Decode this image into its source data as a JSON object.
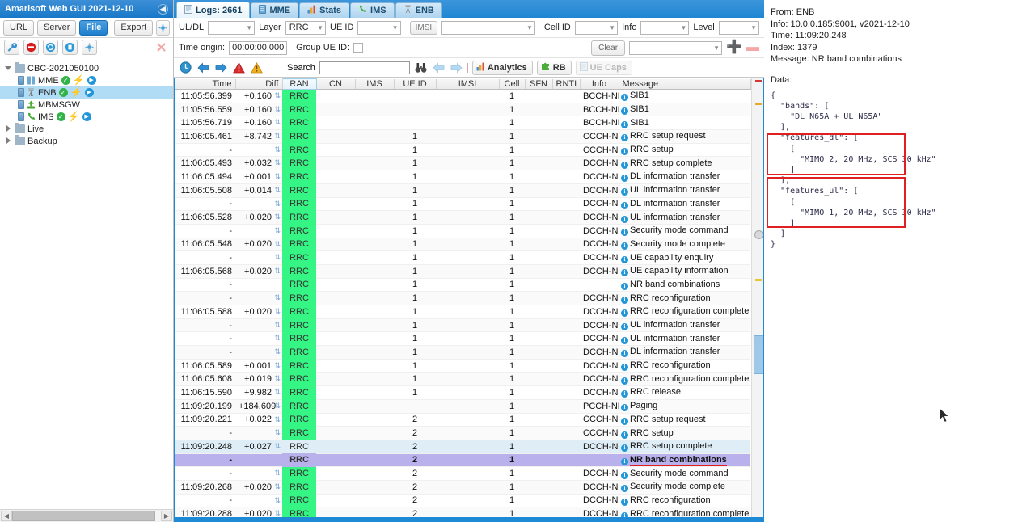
{
  "window": {
    "title": "Amarisoft Web GUI 2021-12-10",
    "collapse_icon": "chevron-left-icon"
  },
  "left_toolbar": {
    "url_label": "URL",
    "server_label": "Server",
    "file_label": "File",
    "export_label": "Export",
    "add_icon": "add-node-icon",
    "tools": [
      "wrench-icon",
      "stop-icon",
      "refresh-icon",
      "pause-icon",
      "connect-icon"
    ],
    "delete_icon": "delete-icon"
  },
  "tree": [
    {
      "label": "CBC-2021050100",
      "type": "folder",
      "twisty": "open",
      "indent": 0,
      "selected": false,
      "badges": []
    },
    {
      "label": "MME",
      "type": "server",
      "twisty": "none",
      "indent": 1,
      "selected": false,
      "badges": [
        "ok",
        "bolt",
        "play"
      ]
    },
    {
      "label": "ENB",
      "type": "server",
      "twisty": "none",
      "indent": 1,
      "selected": true,
      "badges": [
        "ok",
        "bolt",
        "play"
      ]
    },
    {
      "label": "MBMSGW",
      "type": "server",
      "twisty": "none",
      "indent": 1,
      "selected": false,
      "badges": []
    },
    {
      "label": "IMS",
      "type": "server",
      "twisty": "none",
      "indent": 1,
      "selected": false,
      "badges": [
        "ok",
        "bolt",
        "play"
      ]
    },
    {
      "label": "Live",
      "type": "folder",
      "twisty": "closed",
      "indent": 0,
      "selected": false,
      "badges": []
    },
    {
      "label": "Backup",
      "type": "folder",
      "twisty": "closed",
      "indent": 0,
      "selected": false,
      "badges": []
    }
  ],
  "tabs": [
    {
      "label": "Logs: 2661",
      "icon": "document-icon",
      "active": true
    },
    {
      "label": "MME",
      "icon": "server-icon",
      "active": false
    },
    {
      "label": "Stats",
      "icon": "bar-chart-icon",
      "active": false
    },
    {
      "label": "IMS",
      "icon": "phone-icon",
      "active": false
    },
    {
      "label": "ENB",
      "icon": "antenna-icon",
      "active": false
    }
  ],
  "filters": {
    "uldl_label": "UL/DL",
    "uldl_value": "",
    "layer_label": "Layer",
    "layer_value": "RRC",
    "ueid_label": "UE ID",
    "ueid_value": "",
    "imsi_button": "IMSI",
    "imsi_value": "",
    "cellid_label": "Cell ID",
    "cellid_value": "",
    "info_label": "Info",
    "info_value": "",
    "level_label": "Level",
    "level_value": "",
    "time_origin_label": "Time origin:",
    "time_origin_value": "00:00:00.000",
    "group_ueid_label": "Group UE ID:",
    "group_ueid_checked": false,
    "clear_label": "Clear",
    "preset_value": "",
    "add_icon": "plus-icon",
    "remove_icon": "minus-icon"
  },
  "toolbar2": {
    "clock_icon": "clock-icon",
    "prev_icon": "arrow-left-icon",
    "next_icon": "arrow-right-icon",
    "error_icon": "error-triangle-icon",
    "warning_icon": "warning-triangle-icon",
    "search_label": "Search",
    "search_value": "",
    "search_placeholder": "",
    "binoculars_icon": "binoculars-icon",
    "search_prev_icon": "arrow-left-icon",
    "search_next_icon": "arrow-right-icon",
    "analytics_label": "Analytics",
    "analytics_icon": "bar-chart-icon",
    "rb_label": "RB",
    "rb_icon": "puzzle-icon",
    "uecaps_label": "UE Caps",
    "uecaps_icon": "page-icon",
    "uecaps_disabled": true
  },
  "table": {
    "columns": [
      "Time",
      "Diff",
      "RAN",
      "CN",
      "IMS",
      "UE ID",
      "IMSI",
      "Cell",
      "SFN",
      "RNTI",
      "Info",
      "Message"
    ],
    "rows": [
      {
        "time": "11:05:56.399",
        "diff": "+0.160",
        "ran": "RRC",
        "cn": "",
        "ims": "",
        "ueid": "",
        "imsi": "",
        "cell": "1",
        "sfn": "",
        "rnti": "",
        "info": "BCCH-NR",
        "message": "SIB1",
        "state": "normal"
      },
      {
        "time": "11:05:56.559",
        "diff": "+0.160",
        "ran": "RRC",
        "cn": "",
        "ims": "",
        "ueid": "",
        "imsi": "",
        "cell": "1",
        "sfn": "",
        "rnti": "",
        "info": "BCCH-NR",
        "message": "SIB1",
        "state": "alt"
      },
      {
        "time": "11:05:56.719",
        "diff": "+0.160",
        "ran": "RRC",
        "cn": "",
        "ims": "",
        "ueid": "",
        "imsi": "",
        "cell": "1",
        "sfn": "",
        "rnti": "",
        "info": "BCCH-NR",
        "message": "SIB1",
        "state": "normal"
      },
      {
        "time": "11:06:05.461",
        "diff": "+8.742",
        "ran": "RRC",
        "cn": "",
        "ims": "",
        "ueid": "1",
        "imsi": "",
        "cell": "1",
        "sfn": "",
        "rnti": "",
        "info": "CCCH-NR",
        "message": "RRC setup request",
        "state": "alt"
      },
      {
        "time": "-",
        "diff": "",
        "ran": "RRC",
        "cn": "",
        "ims": "",
        "ueid": "1",
        "imsi": "",
        "cell": "1",
        "sfn": "",
        "rnti": "",
        "info": "CCCH-NR",
        "message": "RRC setup",
        "state": "normal"
      },
      {
        "time": "11:06:05.493",
        "diff": "+0.032",
        "ran": "RRC",
        "cn": "",
        "ims": "",
        "ueid": "1",
        "imsi": "",
        "cell": "1",
        "sfn": "",
        "rnti": "",
        "info": "DCCH-NR",
        "message": "RRC setup complete",
        "state": "alt"
      },
      {
        "time": "11:06:05.494",
        "diff": "+0.001",
        "ran": "RRC",
        "cn": "",
        "ims": "",
        "ueid": "1",
        "imsi": "",
        "cell": "1",
        "sfn": "",
        "rnti": "",
        "info": "DCCH-NR",
        "message": "DL information transfer",
        "state": "normal"
      },
      {
        "time": "11:06:05.508",
        "diff": "+0.014",
        "ran": "RRC",
        "cn": "",
        "ims": "",
        "ueid": "1",
        "imsi": "",
        "cell": "1",
        "sfn": "",
        "rnti": "",
        "info": "DCCH-NR",
        "message": "UL information transfer",
        "state": "alt"
      },
      {
        "time": "-",
        "diff": "",
        "ran": "RRC",
        "cn": "",
        "ims": "",
        "ueid": "1",
        "imsi": "",
        "cell": "1",
        "sfn": "",
        "rnti": "",
        "info": "DCCH-NR",
        "message": "DL information transfer",
        "state": "normal"
      },
      {
        "time": "11:06:05.528",
        "diff": "+0.020",
        "ran": "RRC",
        "cn": "",
        "ims": "",
        "ueid": "1",
        "imsi": "",
        "cell": "1",
        "sfn": "",
        "rnti": "",
        "info": "DCCH-NR",
        "message": "UL information transfer",
        "state": "alt"
      },
      {
        "time": "-",
        "diff": "",
        "ran": "RRC",
        "cn": "",
        "ims": "",
        "ueid": "1",
        "imsi": "",
        "cell": "1",
        "sfn": "",
        "rnti": "",
        "info": "DCCH-NR",
        "message": "Security mode command",
        "state": "normal"
      },
      {
        "time": "11:06:05.548",
        "diff": "+0.020",
        "ran": "RRC",
        "cn": "",
        "ims": "",
        "ueid": "1",
        "imsi": "",
        "cell": "1",
        "sfn": "",
        "rnti": "",
        "info": "DCCH-NR",
        "message": "Security mode complete",
        "state": "alt"
      },
      {
        "time": "-",
        "diff": "",
        "ran": "RRC",
        "cn": "",
        "ims": "",
        "ueid": "1",
        "imsi": "",
        "cell": "1",
        "sfn": "",
        "rnti": "",
        "info": "DCCH-NR",
        "message": "UE capability enquiry",
        "state": "normal"
      },
      {
        "time": "11:06:05.568",
        "diff": "+0.020",
        "ran": "RRC",
        "cn": "",
        "ims": "",
        "ueid": "1",
        "imsi": "",
        "cell": "1",
        "sfn": "",
        "rnti": "",
        "info": "DCCH-NR",
        "message": "UE capability information",
        "state": "alt"
      },
      {
        "time": "-",
        "diff": "",
        "ran": "RRC",
        "cn": "",
        "ims": "",
        "ueid": "1",
        "imsi": "",
        "cell": "1",
        "sfn": "",
        "rnti": "",
        "info": "",
        "message": "NR band combinations",
        "state": "normal"
      },
      {
        "time": "-",
        "diff": "",
        "ran": "RRC",
        "cn": "",
        "ims": "",
        "ueid": "1",
        "imsi": "",
        "cell": "1",
        "sfn": "",
        "rnti": "",
        "info": "DCCH-NR",
        "message": "RRC reconfiguration",
        "state": "alt"
      },
      {
        "time": "11:06:05.588",
        "diff": "+0.020",
        "ran": "RRC",
        "cn": "",
        "ims": "",
        "ueid": "1",
        "imsi": "",
        "cell": "1",
        "sfn": "",
        "rnti": "",
        "info": "DCCH-NR",
        "message": "RRC reconfiguration complete",
        "state": "normal"
      },
      {
        "time": "-",
        "diff": "",
        "ran": "RRC",
        "cn": "",
        "ims": "",
        "ueid": "1",
        "imsi": "",
        "cell": "1",
        "sfn": "",
        "rnti": "",
        "info": "DCCH-NR",
        "message": "UL information transfer",
        "state": "alt"
      },
      {
        "time": "-",
        "diff": "",
        "ran": "RRC",
        "cn": "",
        "ims": "",
        "ueid": "1",
        "imsi": "",
        "cell": "1",
        "sfn": "",
        "rnti": "",
        "info": "DCCH-NR",
        "message": "UL information transfer",
        "state": "normal"
      },
      {
        "time": "-",
        "diff": "",
        "ran": "RRC",
        "cn": "",
        "ims": "",
        "ueid": "1",
        "imsi": "",
        "cell": "1",
        "sfn": "",
        "rnti": "",
        "info": "DCCH-NR",
        "message": "DL information transfer",
        "state": "alt"
      },
      {
        "time": "11:06:05.589",
        "diff": "+0.001",
        "ran": "RRC",
        "cn": "",
        "ims": "",
        "ueid": "1",
        "imsi": "",
        "cell": "1",
        "sfn": "",
        "rnti": "",
        "info": "DCCH-NR",
        "message": "RRC reconfiguration",
        "state": "normal"
      },
      {
        "time": "11:06:05.608",
        "diff": "+0.019",
        "ran": "RRC",
        "cn": "",
        "ims": "",
        "ueid": "1",
        "imsi": "",
        "cell": "1",
        "sfn": "",
        "rnti": "",
        "info": "DCCH-NR",
        "message": "RRC reconfiguration complete",
        "state": "alt"
      },
      {
        "time": "11:06:15.590",
        "diff": "+9.982",
        "ran": "RRC",
        "cn": "",
        "ims": "",
        "ueid": "1",
        "imsi": "",
        "cell": "1",
        "sfn": "",
        "rnti": "",
        "info": "DCCH-NR",
        "message": "RRC release",
        "state": "normal"
      },
      {
        "time": "11:09:20.199",
        "diff": "+184.609",
        "ran": "RRC",
        "cn": "",
        "ims": "",
        "ueid": "",
        "imsi": "",
        "cell": "1",
        "sfn": "",
        "rnti": "",
        "info": "PCCH-NR",
        "message": "Paging",
        "state": "alt"
      },
      {
        "time": "11:09:20.221",
        "diff": "+0.022",
        "ran": "RRC",
        "cn": "",
        "ims": "",
        "ueid": "2",
        "imsi": "",
        "cell": "1",
        "sfn": "",
        "rnti": "",
        "info": "CCCH-NR",
        "message": "RRC setup request",
        "state": "normal"
      },
      {
        "time": "-",
        "diff": "",
        "ran": "RRC",
        "cn": "",
        "ims": "",
        "ueid": "2",
        "imsi": "",
        "cell": "1",
        "sfn": "",
        "rnti": "",
        "info": "CCCH-NR",
        "message": "RRC setup",
        "state": "alt"
      },
      {
        "time": "11:09:20.248",
        "diff": "+0.027",
        "ran": "RRC",
        "cn": "",
        "ims": "",
        "ueid": "2",
        "imsi": "",
        "cell": "1",
        "sfn": "",
        "rnti": "",
        "info": "DCCH-NR",
        "message": "RRC setup complete",
        "state": "selected"
      },
      {
        "time": "-",
        "diff": "",
        "ran": "RRC",
        "cn": "",
        "ims": "",
        "ueid": "2",
        "imsi": "",
        "cell": "1",
        "sfn": "",
        "rnti": "",
        "info": "",
        "message": "NR band combinations",
        "state": "highlight"
      },
      {
        "time": "-",
        "diff": "",
        "ran": "RRC",
        "cn": "",
        "ims": "",
        "ueid": "2",
        "imsi": "",
        "cell": "1",
        "sfn": "",
        "rnti": "",
        "info": "DCCH-NR",
        "message": "Security mode command",
        "state": "normal"
      },
      {
        "time": "11:09:20.268",
        "diff": "+0.020",
        "ran": "RRC",
        "cn": "",
        "ims": "",
        "ueid": "2",
        "imsi": "",
        "cell": "1",
        "sfn": "",
        "rnti": "",
        "info": "DCCH-NR",
        "message": "Security mode complete",
        "state": "alt"
      },
      {
        "time": "-",
        "diff": "",
        "ran": "RRC",
        "cn": "",
        "ims": "",
        "ueid": "2",
        "imsi": "",
        "cell": "1",
        "sfn": "",
        "rnti": "",
        "info": "DCCH-NR",
        "message": "RRC reconfiguration",
        "state": "normal"
      },
      {
        "time": "11:09:20.288",
        "diff": "+0.020",
        "ran": "RRC",
        "cn": "",
        "ims": "",
        "ueid": "2",
        "imsi": "",
        "cell": "1",
        "sfn": "",
        "rnti": "",
        "info": "DCCH-NR",
        "message": "RRC reconfiguration complete",
        "state": "alt"
      }
    ]
  },
  "details": {
    "from": "From: ENB",
    "info": "Info: 10.0.0.185:9001, v2021-12-10",
    "time": "Time: 11:09:20.248",
    "index": "Index: 1379",
    "message": "Message: NR band combinations",
    "data_label": "Data:",
    "json": "{\n  \"bands\": [\n    \"DL N65A + UL N65A\"\n  ],\n  \"features_dl\": [\n    [\n      \"MIMO 2, 20 MHz, SCS 30 kHz\"\n    ]\n  ],\n  \"features_ul\": [\n    [\n      \"MIMO 1, 20 MHz, SCS 30 kHz\"\n    ]\n  ]\n}"
  },
  "annotations": {
    "highlight_color": "#e02020",
    "selected_row_color": "#b9b1ec",
    "ran_cell_color": "#35f584"
  }
}
